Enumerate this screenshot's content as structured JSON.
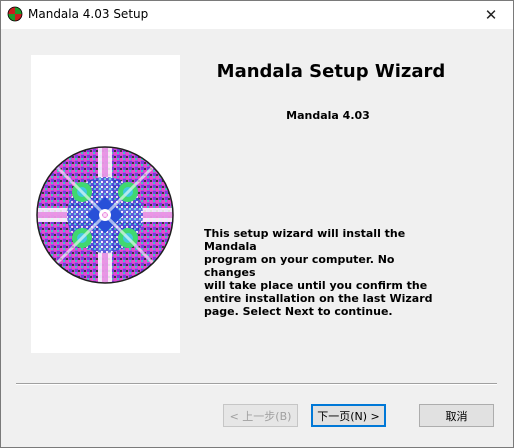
{
  "window": {
    "title": "Mandala 4.03 Setup",
    "close_glyph": "✕"
  },
  "wizard": {
    "heading": "Mandala Setup Wizard",
    "version": "Mandala 4.03",
    "description_lines": [
      "This setup wizard will install the Mandala",
      "program on your computer. No changes",
      "will take place until you confirm the",
      "entire installation on the last Wizard",
      "page. Select Next to continue."
    ]
  },
  "buttons": {
    "back": {
      "label": "< 上一步(B)",
      "enabled": false
    },
    "next": {
      "label": "下一页(N) >",
      "enabled": true
    },
    "cancel": {
      "label": "取消",
      "enabled": true
    }
  },
  "icons": {
    "app": "mandala-app-icon",
    "side_image": "mandala-artwork"
  },
  "colors": {
    "mandala_palette": [
      "#e040c8",
      "#8a3cd8",
      "#3cc8c8",
      "#40d860",
      "#2850d8",
      "#ffffff",
      "#d8d8d8",
      "#202020"
    ]
  }
}
